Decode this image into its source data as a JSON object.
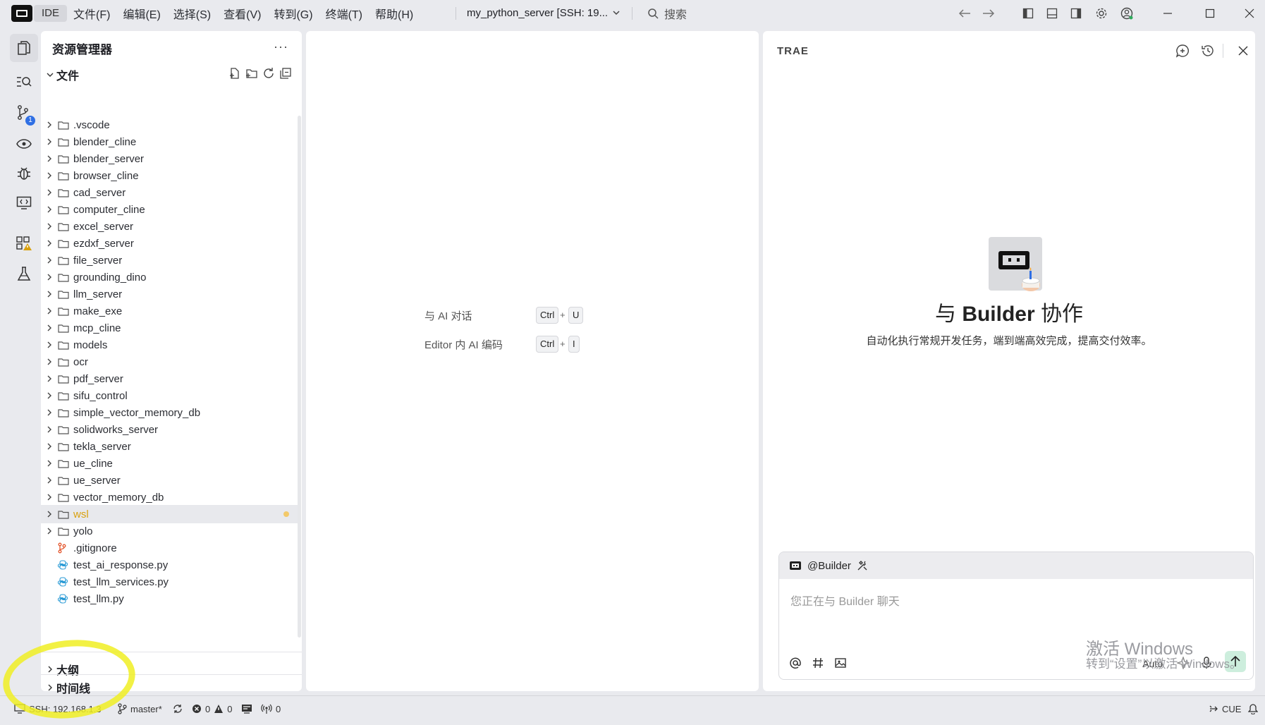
{
  "titlebar": {
    "app_badge": "IDE",
    "menu": [
      "文件(F)",
      "编辑(E)",
      "选择(S)",
      "查看(V)",
      "转到(G)",
      "终端(T)",
      "帮助(H)"
    ],
    "project": "my_python_server [SSH: 19...",
    "search_label": "搜索"
  },
  "explorer": {
    "title": "资源管理器",
    "more": "···",
    "files_section": "文件",
    "items": [
      {
        "name": ".vscode",
        "type": "folder"
      },
      {
        "name": "blender_cline",
        "type": "folder"
      },
      {
        "name": "blender_server",
        "type": "folder"
      },
      {
        "name": "browser_cline",
        "type": "folder"
      },
      {
        "name": "cad_server",
        "type": "folder"
      },
      {
        "name": "computer_cline",
        "type": "folder"
      },
      {
        "name": "excel_server",
        "type": "folder"
      },
      {
        "name": "ezdxf_server",
        "type": "folder"
      },
      {
        "name": "file_server",
        "type": "folder"
      },
      {
        "name": "grounding_dino",
        "type": "folder"
      },
      {
        "name": "llm_server",
        "type": "folder"
      },
      {
        "name": "make_exe",
        "type": "folder"
      },
      {
        "name": "mcp_cline",
        "type": "folder"
      },
      {
        "name": "models",
        "type": "folder"
      },
      {
        "name": "ocr",
        "type": "folder"
      },
      {
        "name": "pdf_server",
        "type": "folder"
      },
      {
        "name": "sifu_control",
        "type": "folder"
      },
      {
        "name": "simple_vector_memory_db",
        "type": "folder"
      },
      {
        "name": "solidworks_server",
        "type": "folder"
      },
      {
        "name": "tekla_server",
        "type": "folder"
      },
      {
        "name": "ue_cline",
        "type": "folder"
      },
      {
        "name": "ue_server",
        "type": "folder"
      },
      {
        "name": "vector_memory_db",
        "type": "folder"
      },
      {
        "name": "wsl",
        "type": "folder",
        "selected": true,
        "modified": true
      },
      {
        "name": "yolo",
        "type": "folder"
      },
      {
        "name": ".gitignore",
        "type": "git"
      },
      {
        "name": "test_ai_response.py",
        "type": "python"
      },
      {
        "name": "test_llm_services.py",
        "type": "python"
      },
      {
        "name": "test_llm.py",
        "type": "python"
      }
    ],
    "outline_section": "大纲",
    "timeline_section": "时间线"
  },
  "editor": {
    "hints": [
      {
        "label": "与 AI 对话",
        "keys": [
          "Ctrl",
          "U"
        ]
      },
      {
        "label": "Editor 内 AI 编码",
        "keys": [
          "Ctrl",
          "I"
        ]
      }
    ],
    "plus": "+"
  },
  "ai_panel": {
    "title": "TRAE",
    "headline_prefix": "与",
    "headline_builder": "Builder",
    "headline_suffix": "协作",
    "subtitle": "自动化执行常规开发任务，端到端高效完成，提高交付效率。",
    "agent": "@Builder",
    "input_placeholder": "您正在与 Builder 聊天",
    "mode": "Auto"
  },
  "watermark": {
    "line1": "激活 Windows",
    "line2": "转到“设置”以激活 Windows。"
  },
  "statusbar": {
    "ssh": "SSH: 192.168.1.3",
    "branch": "master*",
    "errors": "0",
    "warnings": "0",
    "ports": "0",
    "cue": "CUE"
  },
  "badges": {
    "source_control": "1"
  },
  "colors": {
    "accent_green": "#cdeedd",
    "modified": "#d9a10f",
    "python_icon": "#2b9bd6",
    "git_icon": "#e4572e",
    "badge_blue": "#2f6fe4"
  }
}
